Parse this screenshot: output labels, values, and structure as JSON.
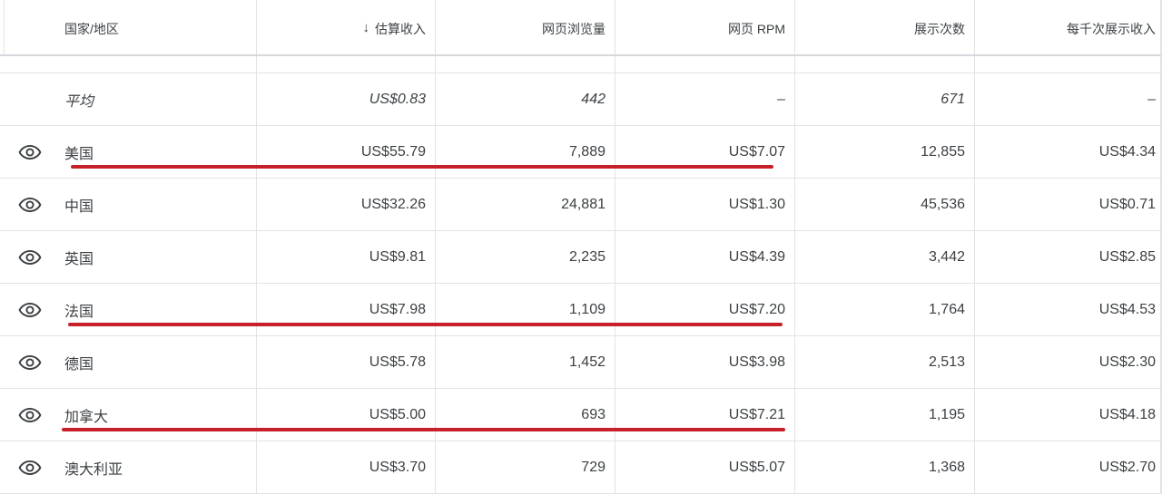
{
  "header": {
    "country": "国家/地区",
    "sort_arrow": "↓",
    "est_revenue": "估算收入",
    "page_views": "网页浏览量",
    "page_rpm": "网页 RPM",
    "impressions": "展示次数",
    "impression_rpm": "每千次展示收入"
  },
  "average": {
    "label": "平均",
    "est_revenue": "US$0.83",
    "page_views": "442",
    "page_rpm": "–",
    "impressions": "671",
    "impression_rpm": "–"
  },
  "rows": [
    {
      "country": "美国",
      "est_revenue": "US$55.79",
      "page_views": "7,889",
      "page_rpm": "US$7.07",
      "impressions": "12,855",
      "impression_rpm": "US$4.34",
      "highlighted": true
    },
    {
      "country": "中国",
      "est_revenue": "US$32.26",
      "page_views": "24,881",
      "page_rpm": "US$1.30",
      "impressions": "45,536",
      "impression_rpm": "US$0.71",
      "highlighted": false
    },
    {
      "country": "英国",
      "est_revenue": "US$9.81",
      "page_views": "2,235",
      "page_rpm": "US$4.39",
      "impressions": "3,442",
      "impression_rpm": "US$2.85",
      "highlighted": false
    },
    {
      "country": "法国",
      "est_revenue": "US$7.98",
      "page_views": "1,109",
      "page_rpm": "US$7.20",
      "impressions": "1,764",
      "impression_rpm": "US$4.53",
      "highlighted": true
    },
    {
      "country": "德国",
      "est_revenue": "US$5.78",
      "page_views": "1,452",
      "page_rpm": "US$3.98",
      "impressions": "2,513",
      "impression_rpm": "US$2.30",
      "highlighted": false
    },
    {
      "country": "加拿大",
      "est_revenue": "US$5.00",
      "page_views": "693",
      "page_rpm": "US$7.21",
      "impressions": "1,195",
      "impression_rpm": "US$4.18",
      "highlighted": true
    },
    {
      "country": "澳大利亚",
      "est_revenue": "US$3.70",
      "page_views": "729",
      "page_rpm": "US$5.07",
      "impressions": "1,368",
      "impression_rpm": "US$2.70",
      "highlighted": false
    }
  ],
  "colors": {
    "text": "#3c4043",
    "grid": "#e3e3e3",
    "underline": "#c8202a"
  },
  "icons": {
    "row_visibility": "eye-icon",
    "sort": "arrow-down-icon"
  }
}
